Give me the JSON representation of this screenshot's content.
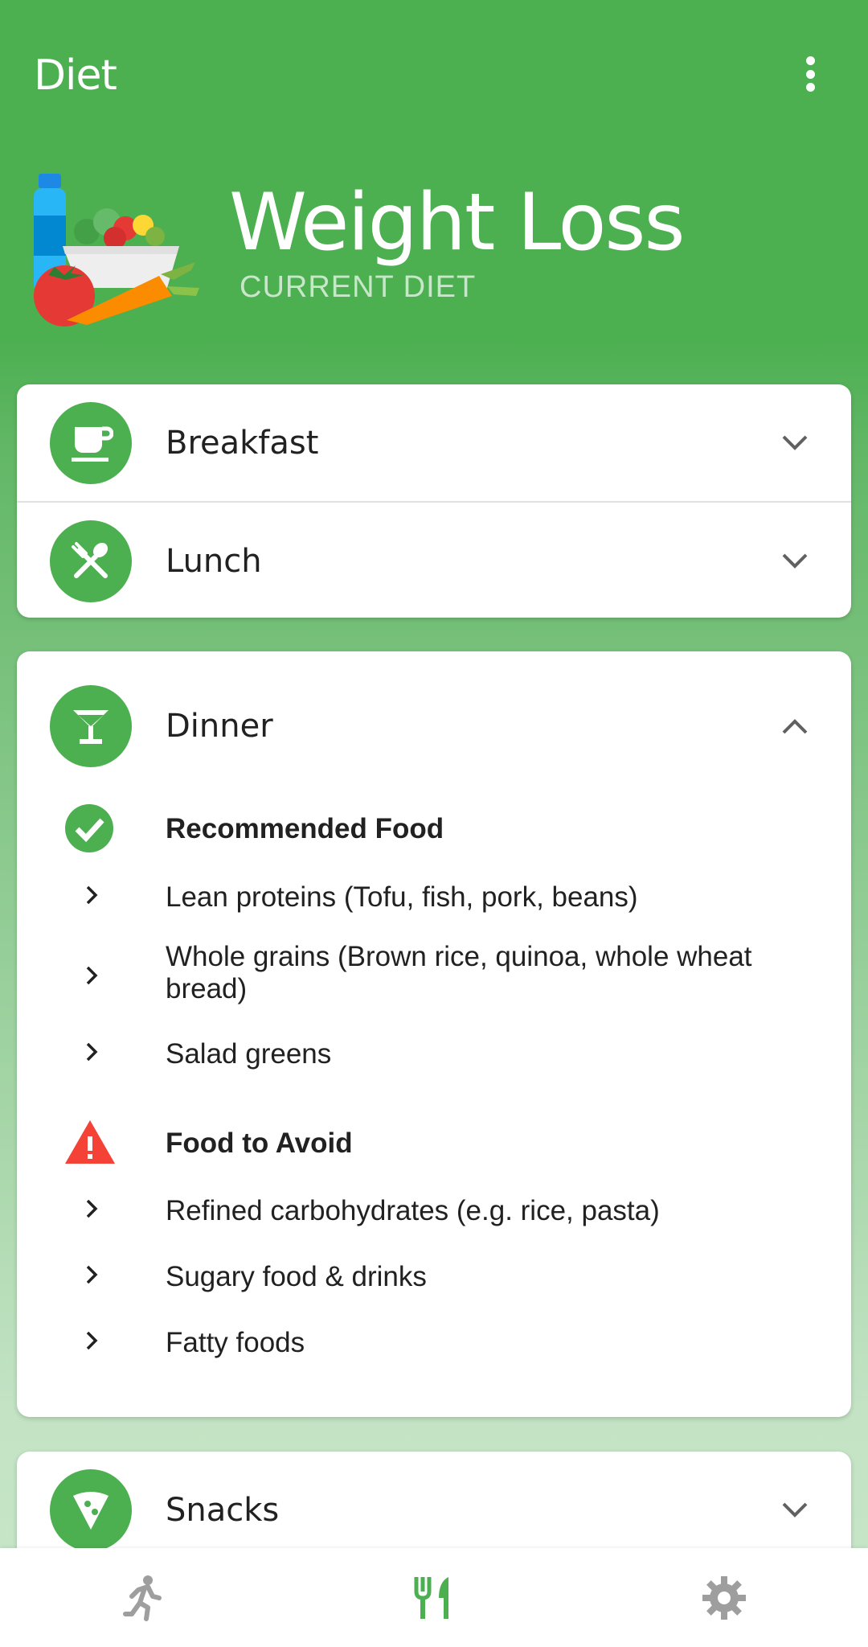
{
  "app": {
    "title": "Diet"
  },
  "hero": {
    "title": "Weight Loss",
    "subtitle": "CURRENT DIET"
  },
  "meals": {
    "breakfast": {
      "label": "Breakfast",
      "icon": "coffee-cup-icon",
      "expanded": false
    },
    "lunch": {
      "label": "Lunch",
      "icon": "utensils-crossed-icon",
      "expanded": false
    },
    "dinner": {
      "label": "Dinner",
      "icon": "cocktail-glass-icon",
      "expanded": true,
      "recommended": {
        "title": "Recommended Food",
        "icon": "check-circle-icon",
        "items": [
          "Lean proteins (Tofu, fish, pork, beans)",
          "Whole grains (Brown rice, quinoa, whole wheat bread)",
          "Salad greens"
        ]
      },
      "avoid": {
        "title": "Food to Avoid",
        "icon": "warning-triangle-icon",
        "items": [
          "Refined carbohydrates (e.g. rice, pasta)",
          "Sugary food & drinks",
          "Fatty foods"
        ]
      }
    },
    "snacks": {
      "label": "Snacks",
      "icon": "pizza-slice-icon",
      "expanded": false
    }
  },
  "bottom_nav": {
    "items": [
      {
        "icon": "running-person-icon",
        "active": false
      },
      {
        "icon": "fork-knife-icon",
        "active": true
      },
      {
        "icon": "gear-icon",
        "active": false
      }
    ]
  },
  "colors": {
    "primary": "#4caf50",
    "subtitle": "#c8e6c9",
    "warning": "#f44336",
    "icon_inactive": "#9e9e9e"
  }
}
